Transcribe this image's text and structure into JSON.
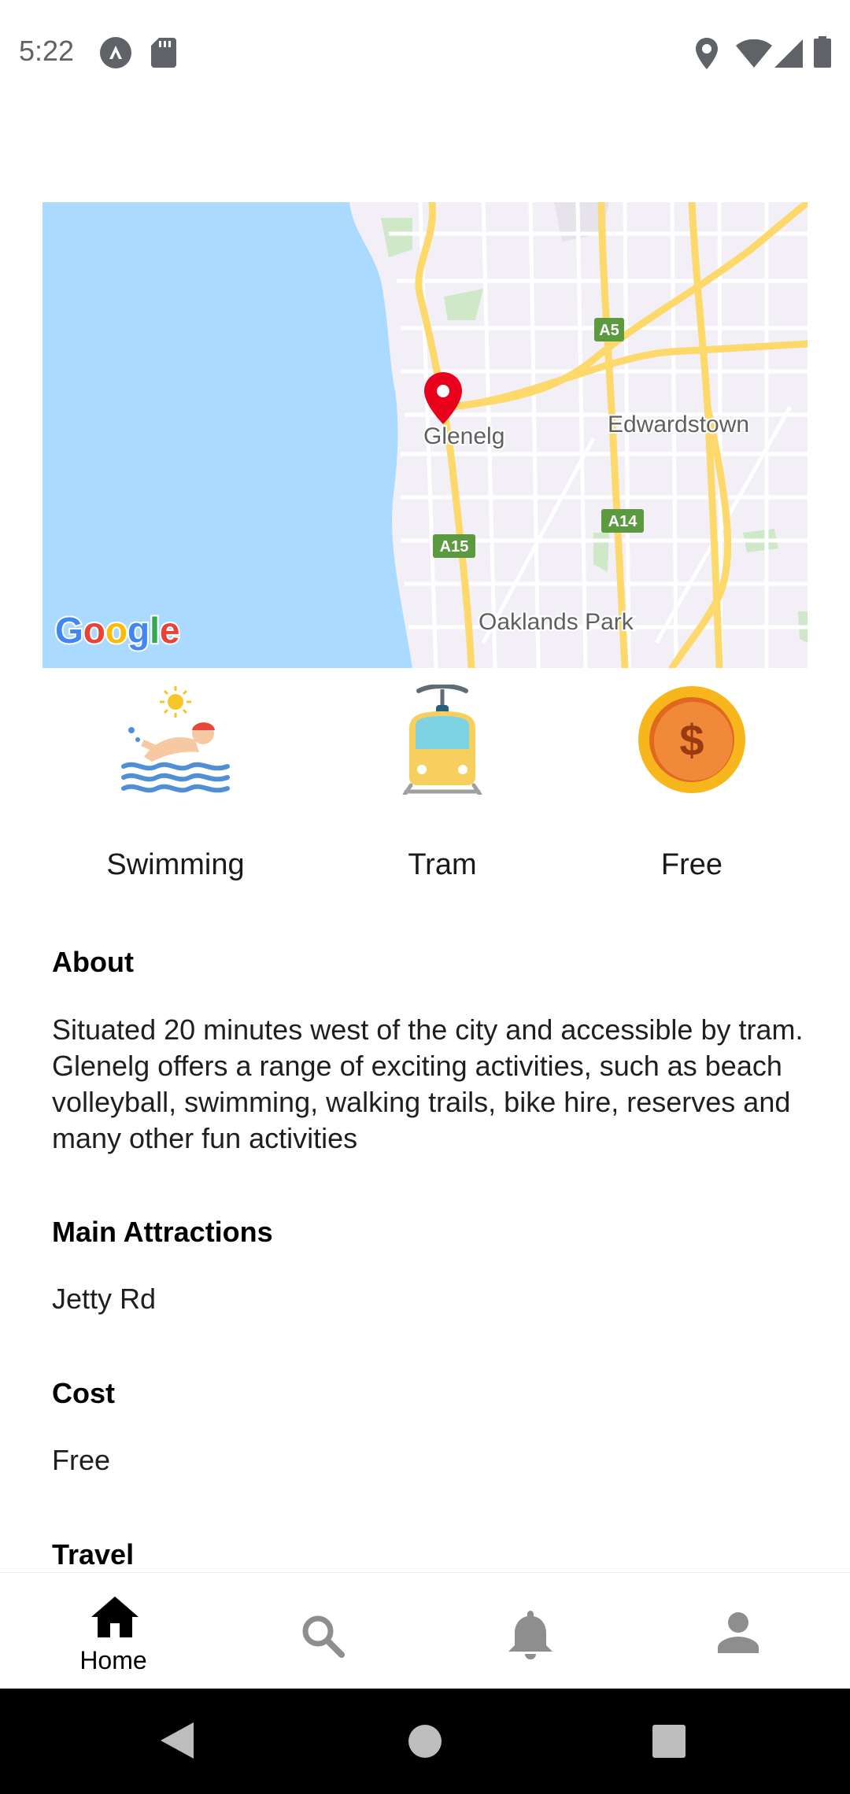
{
  "status_bar": {
    "time": "5:22",
    "left_icons": [
      "android-auto-icon",
      "sd-card-icon"
    ],
    "right_icons": [
      "location-icon",
      "wifi-icon",
      "signal-icon",
      "battery-icon"
    ]
  },
  "map": {
    "attribution": "Google",
    "places": {
      "marker": "Glenelg",
      "suburb_1": "Edwardstown",
      "suburb_2": "Oaklands Park"
    },
    "roads": {
      "a5": "A5",
      "a14": "A14",
      "a15": "A15"
    },
    "colors": {
      "water": "#aadaff",
      "land": "#f2eff6",
      "road_major": "#fdd96c",
      "road_shield": "#5b9a3f",
      "marker": "#e8001c"
    }
  },
  "amenities": [
    {
      "label": "Swimming",
      "icon": "swimming-icon"
    },
    {
      "label": "Tram",
      "icon": "tram-icon"
    },
    {
      "label": "Free",
      "icon": "dollar-coin-icon"
    }
  ],
  "about": {
    "title": "About",
    "text": "Situated 20 minutes west of the city and accessible by tram. Glenelg offers a range of exciting activities, such as beach volleyball, swimming, walking trails, bike hire, reserves and many other fun activities"
  },
  "main_attractions": {
    "title": "Main Attractions",
    "text": "Jetty Rd"
  },
  "cost": {
    "title": "Cost",
    "text": "Free"
  },
  "travel": {
    "title": "Travel"
  },
  "bottom_nav": {
    "items": [
      {
        "label": "Home",
        "icon": "home-icon",
        "active": true
      },
      {
        "label": "",
        "icon": "search-icon",
        "active": false
      },
      {
        "label": "",
        "icon": "bell-icon",
        "active": false
      },
      {
        "label": "",
        "icon": "person-icon",
        "active": false
      }
    ]
  },
  "system_nav": {
    "buttons": [
      "back-icon",
      "home-circle-icon",
      "recents-icon"
    ]
  }
}
